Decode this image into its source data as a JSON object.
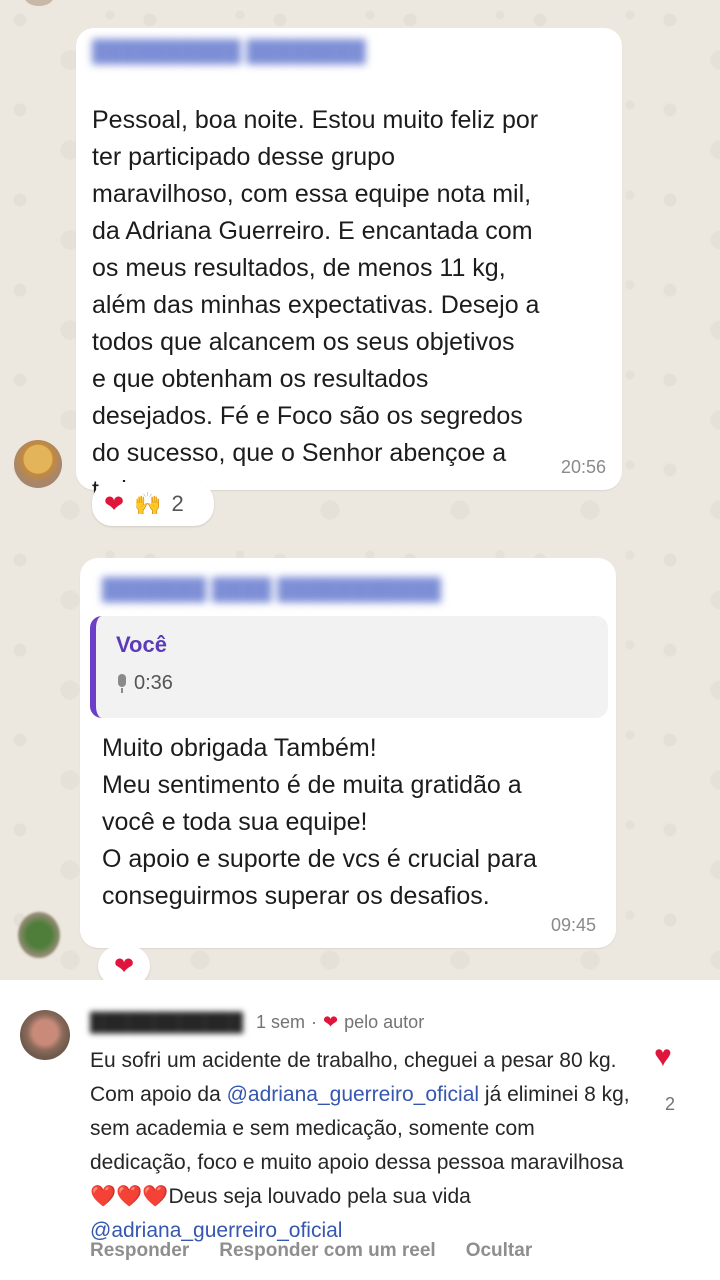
{
  "messages": [
    {
      "text": "Pessoal, boa noite. Estou muito feliz por\nter participado desse grupo\nmaravilhoso,  com essa equipe nota mil,\nda Adriana  Guerreiro. E encantada com\nos meus resultados, de menos 11 kg,\nalém das minhas expectativas. Desejo a\ntodos que alcancem  os seus objetivos\ne que obtenham os resultados\ndesejados. Fé e Foco são os segredos\ndo sucesso, que o Senhor abençoe a\ntodos.",
      "time": "20:56",
      "reaction_count": "2"
    },
    {
      "quote_name": "Você",
      "quote_duration": "0:36",
      "text": "Muito obrigada Também!\nMeu sentimento é de muita gratidão a\nvocê e toda sua equipe!\nO apoio e suporte de vcs é crucial para\nconseguirmos superar os desafios.",
      "time": "09:45"
    }
  ],
  "comment": {
    "age": "1 sem",
    "author_tag": "pelo autor",
    "text_1": "Eu sofri um acidente de trabalho, cheguei a pesar 80 kg. Com apoio da ",
    "mention_1": "@adriana_guerreiro_oficial",
    "text_2": " já eliminei 8 kg, sem academia e sem medicação, somente com dedicação, foco e muito apoio dessa pessoa maravilhosa ",
    "text_3": "Deus seja louvado pela sua vida ",
    "mention_2": "@adriana_guerreiro_oficial",
    "like_count": "2",
    "actions": {
      "reply": "Responder",
      "reply_reel": "Responder com um reel",
      "hide": "Ocultar"
    }
  },
  "icons": {
    "heart": "heart-icon",
    "raised_hands": "raised-hands-icon",
    "mic": "microphone-icon"
  },
  "colors": {
    "accent_purple": "#6b3fc8",
    "heart_red": "#e0153b",
    "mention_blue": "#3557b0"
  }
}
